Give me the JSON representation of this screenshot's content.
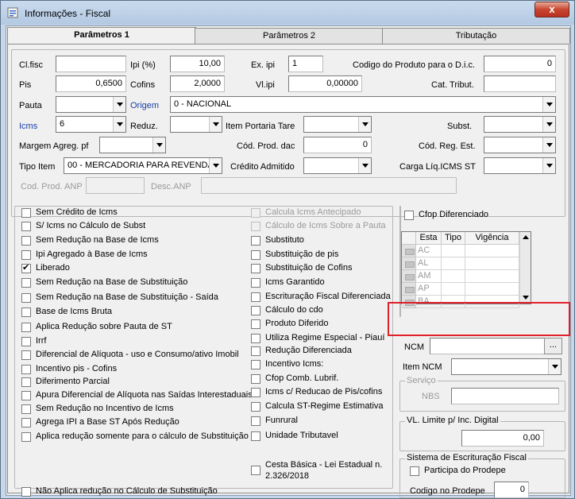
{
  "window": {
    "title": "Informações  - Fiscal",
    "close_label": "x"
  },
  "tabs": [
    "Parâmetros 1",
    "Parâmetros 2",
    "Tributação"
  ],
  "fields": {
    "cl_fisc": {
      "label": "Cl.fisc",
      "value": ""
    },
    "ipi_pct": {
      "label": "Ipi (%)",
      "value": "10,00"
    },
    "ex_ipi": {
      "label": "Ex. ipi",
      "value": "1"
    },
    "codigo_dic": {
      "label": "Codigo do Produto para o D.i.c.",
      "value": "0"
    },
    "pis": {
      "label": "Pis",
      "value": "0,6500"
    },
    "cofins": {
      "label": "Cofins",
      "value": "2,0000"
    },
    "vl_ipi": {
      "label": "Vl.ipi",
      "value": "0,00000"
    },
    "cat_tribut": {
      "label": "Cat. Tribut.",
      "value": ""
    },
    "pauta": {
      "label": "Pauta",
      "value": ""
    },
    "origem": {
      "label": "Origem",
      "value": "0 - NACIONAL"
    },
    "icms": {
      "label": "Icms",
      "value": "6"
    },
    "reduz": {
      "label": "Reduz.",
      "value": ""
    },
    "item_portaria_tare": {
      "label": "Item Portaria Tare",
      "value": ""
    },
    "subst": {
      "label": "Subst.",
      "value": ""
    },
    "margem_agreg": {
      "label": "Margem Agreg. pf",
      "value": ""
    },
    "cod_prod_dac": {
      "label": "Cód. Prod. dac",
      "value": "0"
    },
    "cod_reg_est": {
      "label": "Cód. Reg. Est.",
      "value": ""
    },
    "tipo_item": {
      "label": "Tipo Item",
      "value": "00 - MERCADORIA PARA REVENDA"
    },
    "credito_admitido": {
      "label": "Crédito Admitido",
      "value": ""
    },
    "carga_liq": {
      "label": "Carga Líq.ICMS ST",
      "value": ""
    },
    "cod_prod_anp": {
      "label": "Cod. Prod. ANP",
      "value": ""
    },
    "desc_anp": {
      "label": "Desc.ANP",
      "value": ""
    }
  },
  "checks_left": [
    {
      "label": "Sem Crédito de Icms",
      "checked": false
    },
    {
      "label": "S/ Icms no Cálculo de Subst",
      "checked": false
    },
    {
      "label": "Sem Redução na Base de Icms",
      "checked": false
    },
    {
      "label": "Ipi Agregado à Base de Icms",
      "checked": false
    },
    {
      "label": "Liberado",
      "checked": true
    },
    {
      "label": "Sem Redução na Base de Substituição",
      "checked": false
    },
    {
      "label": "Sem Redução na Base de Substituição - Saída",
      "checked": false
    },
    {
      "label": "Base de Icms Bruta",
      "checked": false
    },
    {
      "label": "Aplica Redução sobre Pauta de ST",
      "checked": false
    },
    {
      "label": "Irrf",
      "checked": false
    },
    {
      "label": "Diferencial de Alíquota - uso e Consumo/ativo Imobil",
      "checked": false
    },
    {
      "label": "Incentivo pis - Cofins",
      "checked": false
    },
    {
      "label": "Diferimento Parcial",
      "checked": false
    },
    {
      "label": "Apura Diferencial de Alíquota nas Saídas Interestaduais",
      "checked": false
    },
    {
      "label": "Sem Redução no Incentivo de Icms",
      "checked": false
    },
    {
      "label": "Agrega IPI a Base ST Após Redução",
      "checked": false
    },
    {
      "label": "Aplica redução somente para o cálculo de Substituição",
      "checked": false
    },
    {
      "label": "Não Aplica redução no Cálculo de Substituição",
      "checked": false
    }
  ],
  "checks_mid": [
    {
      "label": "Calcula Icms Antecipado",
      "disabled": true
    },
    {
      "label": "Cálculo de Icms Sobre a Pauta",
      "disabled": true
    },
    {
      "label": "Substituto",
      "disabled": false
    },
    {
      "label": "Substituição de pis",
      "disabled": false
    },
    {
      "label": "Substituição de Cofins",
      "disabled": false
    },
    {
      "label": "Icms Garantido",
      "disabled": false
    },
    {
      "label": "Escrituração Fiscal Diferenciada",
      "disabled": false
    },
    {
      "label": "Cálculo do cdo",
      "disabled": false
    },
    {
      "label": "Produto Diferido",
      "disabled": false
    },
    {
      "label": "Utiliza Regime Especial - Piauí",
      "disabled": false
    },
    {
      "label": "Redução Diferenciada",
      "disabled": false
    },
    {
      "label": "Incentivo Icms:",
      "disabled": false
    },
    {
      "label": "Cfop Comb. Lubrif.",
      "disabled": false
    },
    {
      "label": "Icms c/ Reducao de Pis/cofins",
      "disabled": false
    },
    {
      "label": "Calcula ST-Regime Estimativa",
      "disabled": false
    },
    {
      "label": "Funrural",
      "disabled": false
    },
    {
      "label": "Unidade Tributavel",
      "disabled": false
    }
  ],
  "cesta_basica": {
    "line1": "Cesta Básica - Lei Estadual n.",
    "line2": "2.326/2018"
  },
  "cfop": {
    "label": "Cfop Diferenciado",
    "columns": [
      "Esta",
      "Tipo",
      "Vigência"
    ],
    "rows": [
      "AC",
      "AL",
      "AM",
      "AP",
      "BA"
    ]
  },
  "ncm": {
    "label": "NCM",
    "value": "",
    "button": "..."
  },
  "item_ncm": {
    "label": "Item NCM",
    "value": ""
  },
  "servico": {
    "legend": "Serviço",
    "nbs_label": "NBS",
    "nbs_value": ""
  },
  "vl_limite": {
    "legend": "VL. Limite p/ Inc. Digital",
    "value": "0,00"
  },
  "sistema": {
    "legend": "Sistema de Escrituração  Fiscal",
    "participa_label": "Participa do Prodepe",
    "codigo_label": "Codigo no Prodepe",
    "codigo_value": "0"
  }
}
